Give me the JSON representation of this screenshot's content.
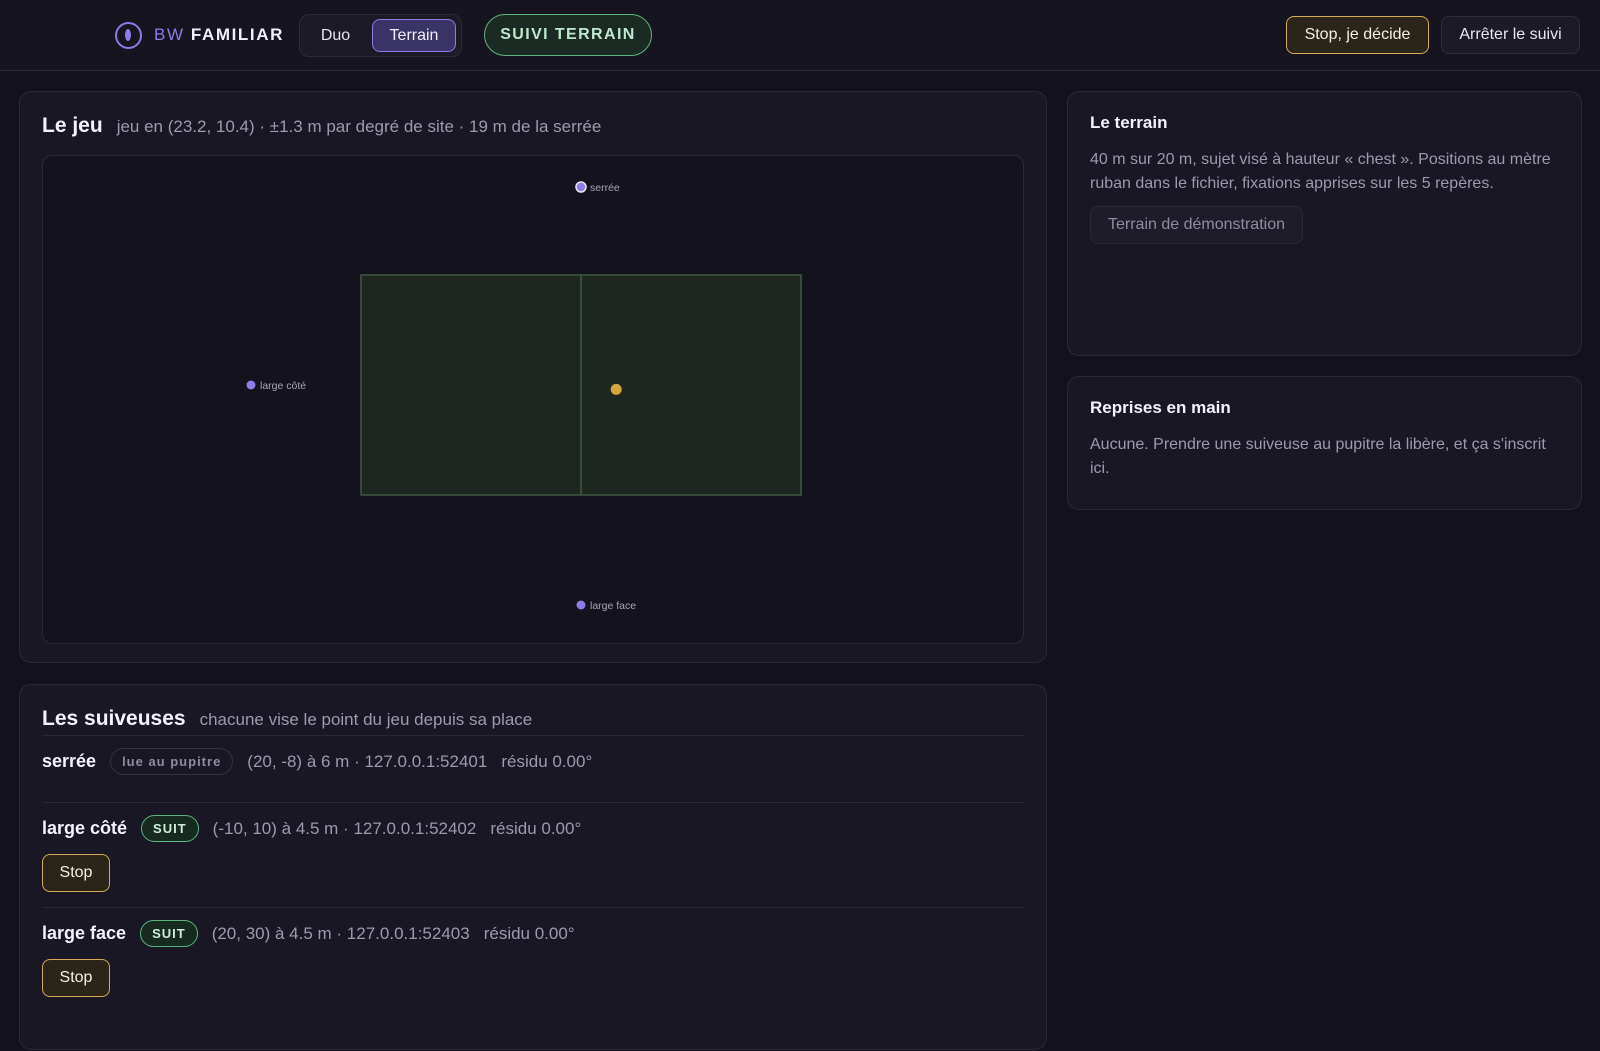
{
  "header": {
    "brand_prefix": "BW",
    "brand_name": "FAMILIAR",
    "tabs": [
      {
        "label": "Duo",
        "active": false
      },
      {
        "label": "Terrain",
        "active": true
      }
    ],
    "mode_label": "SUIVI TERRAIN",
    "stop_decide_label": "Stop, je décide",
    "stop_tracking_label": "Arrêter le suivi"
  },
  "jeu": {
    "title": "Le jeu",
    "subtitle": "jeu en (23.2, 10.4) · ±1.3 m par degré de site · 19 m de la serrée",
    "field": {
      "length_m": 40,
      "width_m": 20,
      "ball": {
        "x": 23.2,
        "y": 10.4,
        "color": "#d6a640"
      },
      "cameras": [
        {
          "label": "serrée",
          "x": 20,
          "y": -8,
          "highlight": true
        },
        {
          "label": "large côté",
          "x": -10,
          "y": 10,
          "highlight": false
        },
        {
          "label": "large face",
          "x": 20,
          "y": 30,
          "highlight": false
        }
      ]
    }
  },
  "suiveuses": {
    "title": "Les suiveuses",
    "subtitle": "chacune vise le point du jeu depuis sa place",
    "items": [
      {
        "name": "serrée",
        "badge": "lue au pupitre",
        "badge_type": "muted",
        "info": "(20, -8) à 6 m · 127.0.0.1:52401",
        "residu": "résidu 0.00°",
        "stop_label": null
      },
      {
        "name": "large côté",
        "badge": "SUIT",
        "badge_type": "suit",
        "info": "(-10, 10) à 4.5 m · 127.0.0.1:52402",
        "residu": "résidu 0.00°",
        "stop_label": "Stop"
      },
      {
        "name": "large face",
        "badge": "SUIT",
        "badge_type": "suit",
        "info": "(20, 30) à 4.5 m · 127.0.0.1:52403",
        "residu": "résidu 0.00°",
        "stop_label": "Stop"
      }
    ]
  },
  "terrain": {
    "title": "Le terrain",
    "description": "40 m sur 20 m, sujet visé à hauteur « chest ». Positions au mètre ruban dans le fichier, fixations apprises sur les 5 repères.",
    "demo_label": "Terrain de démonstration"
  },
  "reprises": {
    "title": "Reprises en main",
    "text": "Aucune. Prendre une suiveuse au pupitre la libère, et ça s'inscrit ici."
  },
  "colors": {
    "accent": "#8b7ce8",
    "field_fill": "#1d261f",
    "field_line": "#3e5a44",
    "suit_green": "#5fb381",
    "stop_amber": "#d6ab5a"
  }
}
